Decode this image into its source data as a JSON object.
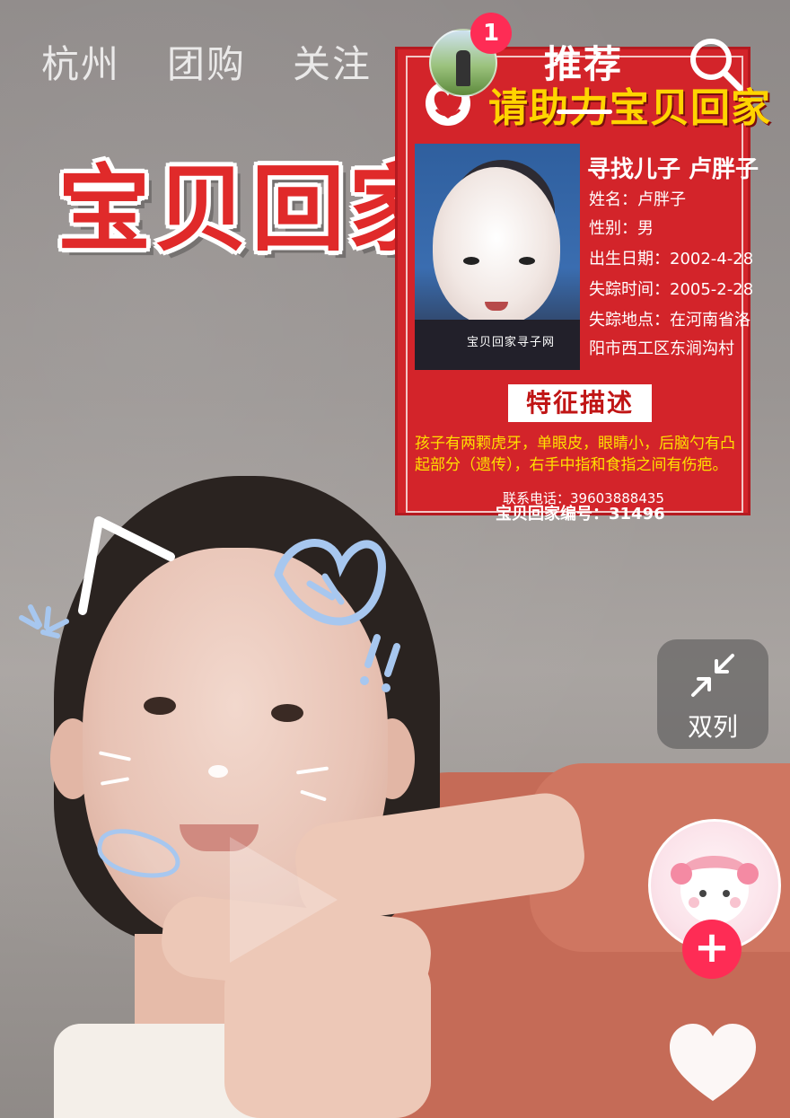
{
  "nav": {
    "tabs": [
      "杭州",
      "团购",
      "关注",
      "推荐"
    ],
    "active_tab": "推荐",
    "notification_count": "1"
  },
  "sticker": {
    "title": "宝贝回家"
  },
  "poster": {
    "heading": "请助力宝贝回家",
    "subtitle": "寻找儿子  卢胖子",
    "fields": [
      "姓名：卢胖子",
      "性别：男",
      "出生日期：2002-4-28",
      "失踪时间：2005-2-28",
      "失踪地点：在河南省洛",
      "阳市西工区东涧沟村"
    ],
    "photo_caption": "宝贝回家寻子网",
    "features_title": "特征描述",
    "features_text": "孩子有两颗虎牙，单眼皮，眼睛小，后脑勺有凸起部分（遗传），右手中指和食指之间有伤疤。",
    "footer_phone": "联系电话：39603888435",
    "footer_id": "宝贝回家编号：31496"
  },
  "controls": {
    "dual_column_label": "双列",
    "follow_label": "+"
  },
  "colors": {
    "accent": "#fe2c55",
    "poster_red": "#d3242a",
    "poster_yellow": "#ffd400"
  },
  "icons": [
    "search-icon",
    "collapse-arrows-icon",
    "heart-icon",
    "plus-icon",
    "heart-shield-logo-icon"
  ]
}
